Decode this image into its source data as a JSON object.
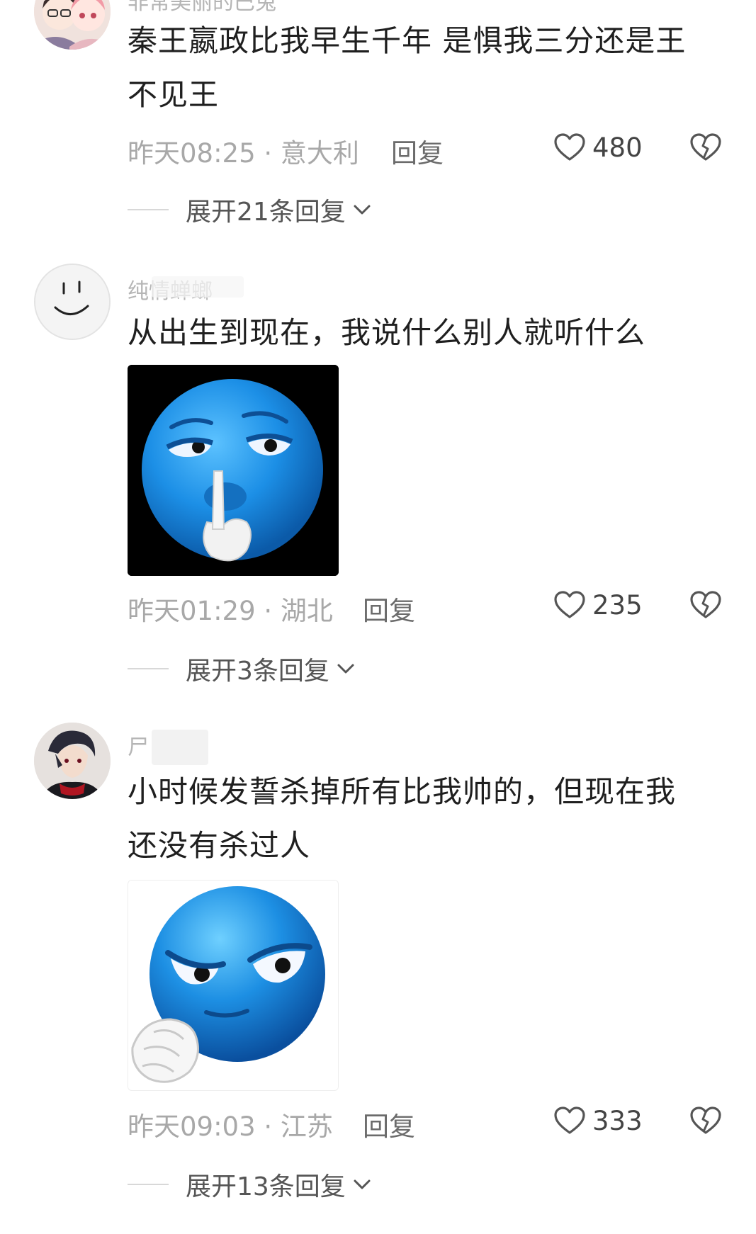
{
  "comments": [
    {
      "username": "非常美丽的巴兔",
      "text_line1": "秦王嬴政比我早生千年 是惧我三分还是王",
      "text_line2": "不见王",
      "time_location": "昨天08:25 · 意大利",
      "reply_label": "回复",
      "likes": "480",
      "expand_label": "展开21条回复"
    },
    {
      "username": "纯情蝉螂",
      "text_line1": "从出生到现在，我说什么别人就听什么",
      "time_location": "昨天01:29 · 湖北",
      "reply_label": "回复",
      "likes": "235",
      "expand_label": "展开3条回复"
    },
    {
      "username": "尸",
      "text_line1": "小时候发誓杀掉所有比我帅的，但现在我",
      "text_line2": "还没有杀过人",
      "time_location": "昨天09:03 · 江苏",
      "reply_label": "回复",
      "likes": "333",
      "expand_label": "展开13条回复"
    }
  ],
  "icons": {
    "like": "heart-outline-icon",
    "dislike": "broken-heart-icon",
    "expand": "chevron-down-icon"
  },
  "colors": {
    "meta_gray": "#a8a8a8",
    "sticker_blue": "#1f8fe0",
    "sticker_bg_dark": "#000000"
  }
}
